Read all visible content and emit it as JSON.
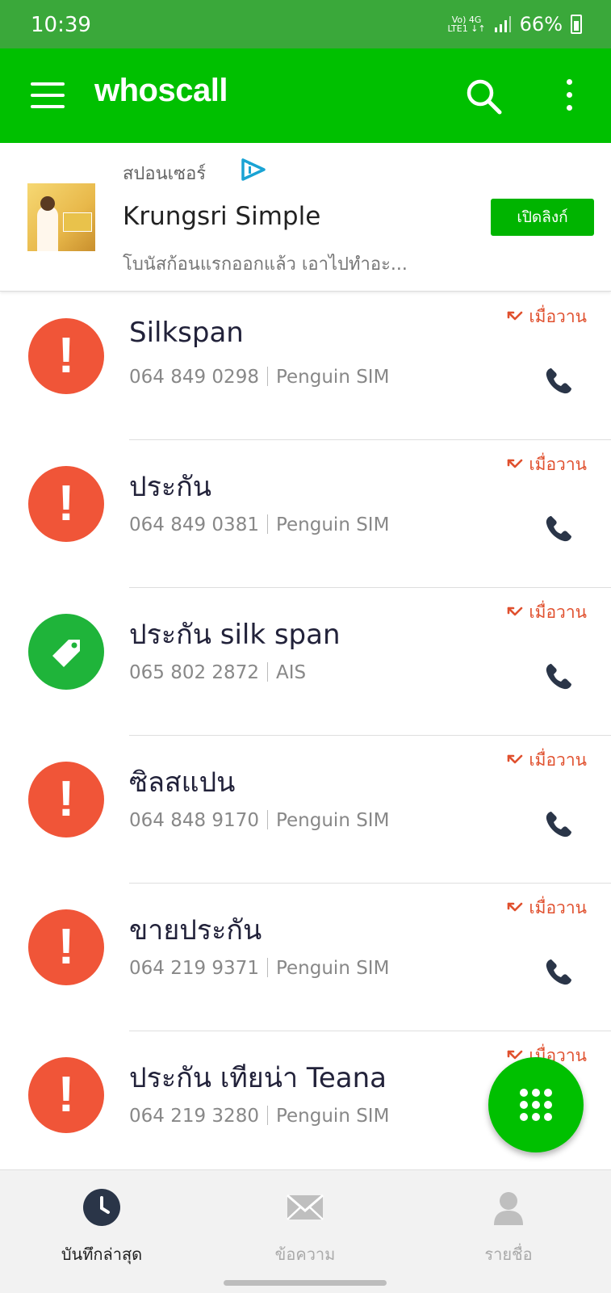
{
  "status_bar": {
    "time": "10:39",
    "network_top": "Vo) 4G",
    "network_bottom": "LTE1 ↓↑",
    "battery": "66%"
  },
  "app_bar": {
    "title": "whoscall",
    "search_icon": "search-icon",
    "menu_icon": "hamburger-icon",
    "more_icon": "more-vert-icon"
  },
  "sponsor": {
    "label": "สปอนเซอร์",
    "title": "Krungsri Simple",
    "description": "โบนัสก้อนแรกออกแล้ว เอาไปทำอะ...",
    "button": "เปิดลิงก์"
  },
  "calls": [
    {
      "name": "Silkspan",
      "number": "064 849 0298",
      "carrier": "Penguin SIM",
      "time": "เมื่อวาน",
      "type": "warning"
    },
    {
      "name": "ประกัน",
      "number": "064 849 0381",
      "carrier": "Penguin SIM",
      "time": "เมื่อวาน",
      "type": "warning"
    },
    {
      "name": "ประกัน silk span",
      "number": "065 802 2872",
      "carrier": "AIS",
      "time": "เมื่อวาน",
      "type": "tag"
    },
    {
      "name": "ซิลสแปน",
      "number": "064 848 9170",
      "carrier": "Penguin SIM",
      "time": "เมื่อวาน",
      "type": "warning"
    },
    {
      "name": "ขายประกัน",
      "number": "064 219 9371",
      "carrier": "Penguin SIM",
      "time": "เมื่อวาน",
      "type": "warning"
    },
    {
      "name": "ประกัน เทียน่า Teana",
      "number": "064 219 3280",
      "carrier": "Penguin SIM",
      "time": "เมื่อวาน",
      "type": "warning"
    }
  ],
  "colors": {
    "brand": "#00c000",
    "warning": "#f05538",
    "tag": "#1fb43a",
    "missed": "#e0502e"
  },
  "bottom_nav": {
    "recent": "บันทึกล่าสุด",
    "messages": "ข้อความ",
    "contacts": "รายชื่อ"
  }
}
